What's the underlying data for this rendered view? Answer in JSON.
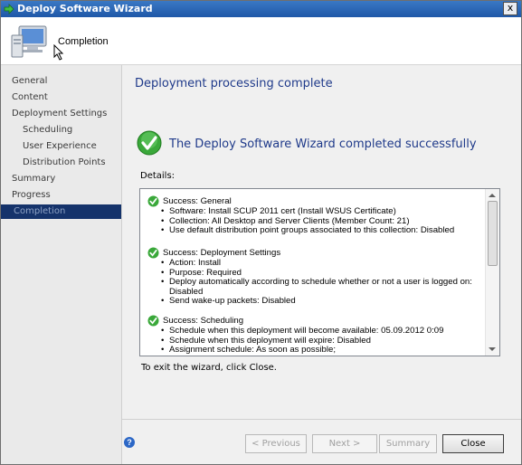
{
  "window": {
    "title": "Deploy Software Wizard",
    "close_glyph": "x"
  },
  "header": {
    "page_title": "Completion"
  },
  "sidebar": {
    "items": [
      {
        "label": "General"
      },
      {
        "label": "Content"
      },
      {
        "label": "Deployment Settings"
      },
      {
        "label": "Scheduling"
      },
      {
        "label": "User Experience"
      },
      {
        "label": "Distribution Points"
      },
      {
        "label": "Summary"
      },
      {
        "label": "Progress"
      },
      {
        "label": "Completion"
      }
    ],
    "active": "Completion"
  },
  "main": {
    "heading": "Deployment processing complete",
    "success_message": "The Deploy Software Wizard completed successfully",
    "details_label": "Details:",
    "exit_text": "To exit the wizard, click Close."
  },
  "details": {
    "sections": [
      {
        "title": "Success: General",
        "items": [
          "Software: Install SCUP 2011 cert (Install WSUS Certificate)",
          "Collection: All Desktop and Server Clients (Member Count: 21)",
          "Use default distribution point groups associated to this collection: Disabled"
        ]
      },
      {
        "title": "Success: Deployment Settings",
        "items": [
          "Action: Install",
          "Purpose: Required",
          "Deploy automatically according to schedule whether or not a user is logged on: Disabled",
          "Send wake-up packets: Disabled"
        ]
      },
      {
        "title": "Success: Scheduling",
        "items": [
          "Schedule when this deployment will become available: 05.09.2012 0:09",
          "Schedule when this deployment will expire: Disabled",
          "Assignment schedule: As soon as possible;"
        ]
      }
    ]
  },
  "buttons": {
    "previous": "< Previous",
    "next": "Next >",
    "summary": "Summary",
    "close": "Close"
  },
  "colors": {
    "accent": "#1f3a8a",
    "nav_active_bg": "#15336b",
    "success_green": "#2e9e2e"
  }
}
